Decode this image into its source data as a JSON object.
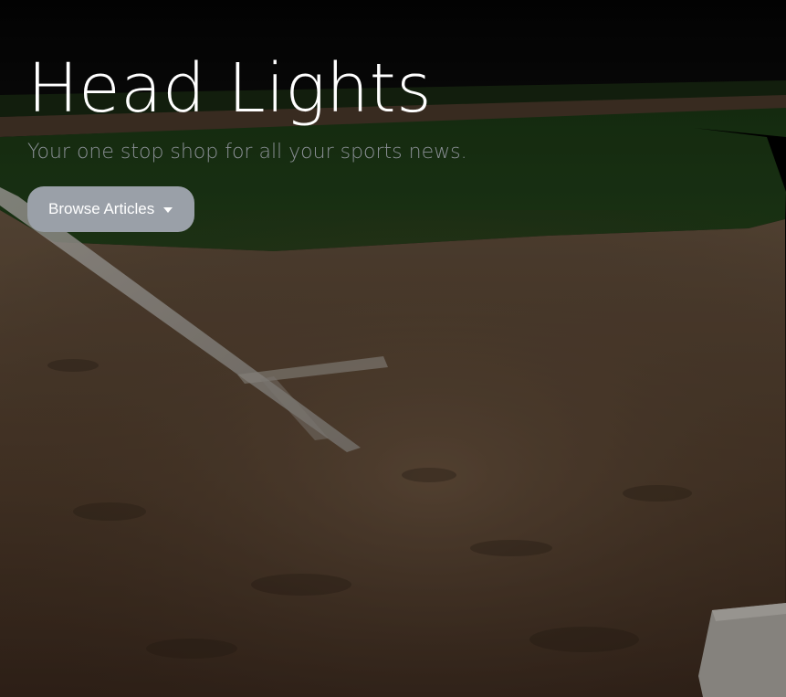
{
  "hero": {
    "title": "Head Lights",
    "subtitle": "Your one stop shop for all your sports news.",
    "browse_button_label": "Browse Articles",
    "browse_button_icon": "caret-down-icon",
    "background_image": "baseball-infield-at-night"
  },
  "colors": {
    "title": "#ffffff",
    "subtitle": "#8a8f95",
    "button_bg": "#9aa0a8",
    "button_text": "#ffffff"
  }
}
